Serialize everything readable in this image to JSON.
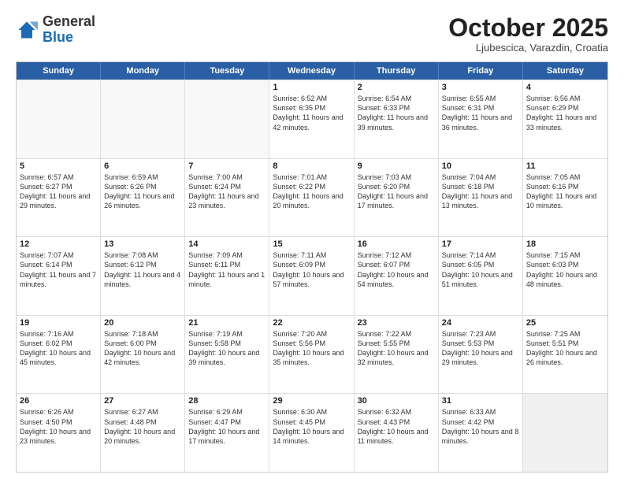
{
  "logo": {
    "general": "General",
    "blue": "Blue"
  },
  "header": {
    "month": "October 2025",
    "location": "Ljubescica, Varazdin, Croatia"
  },
  "weekdays": [
    "Sunday",
    "Monday",
    "Tuesday",
    "Wednesday",
    "Thursday",
    "Friday",
    "Saturday"
  ],
  "weeks": [
    [
      {
        "day": "",
        "info": "",
        "empty": true
      },
      {
        "day": "",
        "info": "",
        "empty": true
      },
      {
        "day": "",
        "info": "",
        "empty": true
      },
      {
        "day": "1",
        "info": "Sunrise: 6:52 AM\nSunset: 6:35 PM\nDaylight: 11 hours\nand 42 minutes."
      },
      {
        "day": "2",
        "info": "Sunrise: 6:54 AM\nSunset: 6:33 PM\nDaylight: 11 hours\nand 39 minutes."
      },
      {
        "day": "3",
        "info": "Sunrise: 6:55 AM\nSunset: 6:31 PM\nDaylight: 11 hours\nand 36 minutes."
      },
      {
        "day": "4",
        "info": "Sunrise: 6:56 AM\nSunset: 6:29 PM\nDaylight: 11 hours\nand 33 minutes."
      }
    ],
    [
      {
        "day": "5",
        "info": "Sunrise: 6:57 AM\nSunset: 6:27 PM\nDaylight: 11 hours\nand 29 minutes."
      },
      {
        "day": "6",
        "info": "Sunrise: 6:59 AM\nSunset: 6:26 PM\nDaylight: 11 hours\nand 26 minutes."
      },
      {
        "day": "7",
        "info": "Sunrise: 7:00 AM\nSunset: 6:24 PM\nDaylight: 11 hours\nand 23 minutes."
      },
      {
        "day": "8",
        "info": "Sunrise: 7:01 AM\nSunset: 6:22 PM\nDaylight: 11 hours\nand 20 minutes."
      },
      {
        "day": "9",
        "info": "Sunrise: 7:03 AM\nSunset: 6:20 PM\nDaylight: 11 hours\nand 17 minutes."
      },
      {
        "day": "10",
        "info": "Sunrise: 7:04 AM\nSunset: 6:18 PM\nDaylight: 11 hours\nand 13 minutes."
      },
      {
        "day": "11",
        "info": "Sunrise: 7:05 AM\nSunset: 6:16 PM\nDaylight: 11 hours\nand 10 minutes."
      }
    ],
    [
      {
        "day": "12",
        "info": "Sunrise: 7:07 AM\nSunset: 6:14 PM\nDaylight: 11 hours\nand 7 minutes."
      },
      {
        "day": "13",
        "info": "Sunrise: 7:08 AM\nSunset: 6:12 PM\nDaylight: 11 hours\nand 4 minutes."
      },
      {
        "day": "14",
        "info": "Sunrise: 7:09 AM\nSunset: 6:11 PM\nDaylight: 11 hours\nand 1 minute."
      },
      {
        "day": "15",
        "info": "Sunrise: 7:11 AM\nSunset: 6:09 PM\nDaylight: 10 hours\nand 57 minutes."
      },
      {
        "day": "16",
        "info": "Sunrise: 7:12 AM\nSunset: 6:07 PM\nDaylight: 10 hours\nand 54 minutes."
      },
      {
        "day": "17",
        "info": "Sunrise: 7:14 AM\nSunset: 6:05 PM\nDaylight: 10 hours\nand 51 minutes."
      },
      {
        "day": "18",
        "info": "Sunrise: 7:15 AM\nSunset: 6:03 PM\nDaylight: 10 hours\nand 48 minutes."
      }
    ],
    [
      {
        "day": "19",
        "info": "Sunrise: 7:16 AM\nSunset: 6:02 PM\nDaylight: 10 hours\nand 45 minutes."
      },
      {
        "day": "20",
        "info": "Sunrise: 7:18 AM\nSunset: 6:00 PM\nDaylight: 10 hours\nand 42 minutes."
      },
      {
        "day": "21",
        "info": "Sunrise: 7:19 AM\nSunset: 5:58 PM\nDaylight: 10 hours\nand 39 minutes."
      },
      {
        "day": "22",
        "info": "Sunrise: 7:20 AM\nSunset: 5:56 PM\nDaylight: 10 hours\nand 35 minutes."
      },
      {
        "day": "23",
        "info": "Sunrise: 7:22 AM\nSunset: 5:55 PM\nDaylight: 10 hours\nand 32 minutes."
      },
      {
        "day": "24",
        "info": "Sunrise: 7:23 AM\nSunset: 5:53 PM\nDaylight: 10 hours\nand 29 minutes."
      },
      {
        "day": "25",
        "info": "Sunrise: 7:25 AM\nSunset: 5:51 PM\nDaylight: 10 hours\nand 26 minutes."
      }
    ],
    [
      {
        "day": "26",
        "info": "Sunrise: 6:26 AM\nSunset: 4:50 PM\nDaylight: 10 hours\nand 23 minutes."
      },
      {
        "day": "27",
        "info": "Sunrise: 6:27 AM\nSunset: 4:48 PM\nDaylight: 10 hours\nand 20 minutes."
      },
      {
        "day": "28",
        "info": "Sunrise: 6:29 AM\nSunset: 4:47 PM\nDaylight: 10 hours\nand 17 minutes."
      },
      {
        "day": "29",
        "info": "Sunrise: 6:30 AM\nSunset: 4:45 PM\nDaylight: 10 hours\nand 14 minutes."
      },
      {
        "day": "30",
        "info": "Sunrise: 6:32 AM\nSunset: 4:43 PM\nDaylight: 10 hours\nand 11 minutes."
      },
      {
        "day": "31",
        "info": "Sunrise: 6:33 AM\nSunset: 4:42 PM\nDaylight: 10 hours\nand 8 minutes."
      },
      {
        "day": "",
        "info": "",
        "empty": true,
        "shaded": true
      }
    ]
  ]
}
